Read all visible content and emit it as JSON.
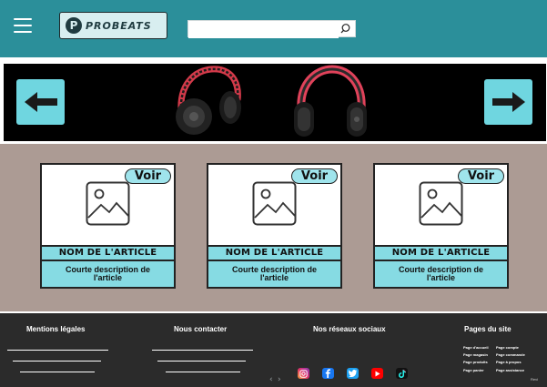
{
  "header": {
    "logo_text": "PROBEATS",
    "logo_mark": "P",
    "search_placeholder": "",
    "bg_color": "#2b8f9a"
  },
  "banner": {
    "prev_icon": "arrow-left-icon",
    "next_icon": "arrow-right-icon",
    "products_shown": [
      "headphone-red-black",
      "headphone-black-red"
    ]
  },
  "products": [
    {
      "button": "Voir",
      "name": "NOM DE L'ARTICLE",
      "desc_line1": "Courte description de",
      "desc_line2": "l'article"
    },
    {
      "button": "Voir",
      "name": "NOM DE L'ARTICLE",
      "desc_line1": "Courte description de",
      "desc_line2": "l'article"
    },
    {
      "button": "Voir",
      "name": "NOM DE L'ARTICLE",
      "desc_line1": "Courte description de",
      "desc_line2": "l'article"
    }
  ],
  "footer": {
    "legal_title": "Mentions légales",
    "contact_title": "Nous contacter",
    "social_title": "Nos réseaux sociaux",
    "pages_title": "Pages du site",
    "social_icons": [
      "instagram-icon",
      "facebook-icon",
      "twitter-icon",
      "youtube-icon",
      "tiktok-icon"
    ],
    "pages": {
      "accueil": "Page d'accueil",
      "compte": "Page compte",
      "magasin": "Page magasin",
      "commande": "Page commande",
      "produits": "Page produits",
      "apropos": "Page à propos",
      "panier": "Page panier",
      "assistance": "Page assistance"
    },
    "carousel_prev": "‹",
    "carousel_next": "›",
    "corner_note": "Revi"
  },
  "colors": {
    "teal": "#2b8f9a",
    "light_cyan": "#86dbe3",
    "taupe": "#ac9b94",
    "footer_dark": "#2b2b2b"
  }
}
